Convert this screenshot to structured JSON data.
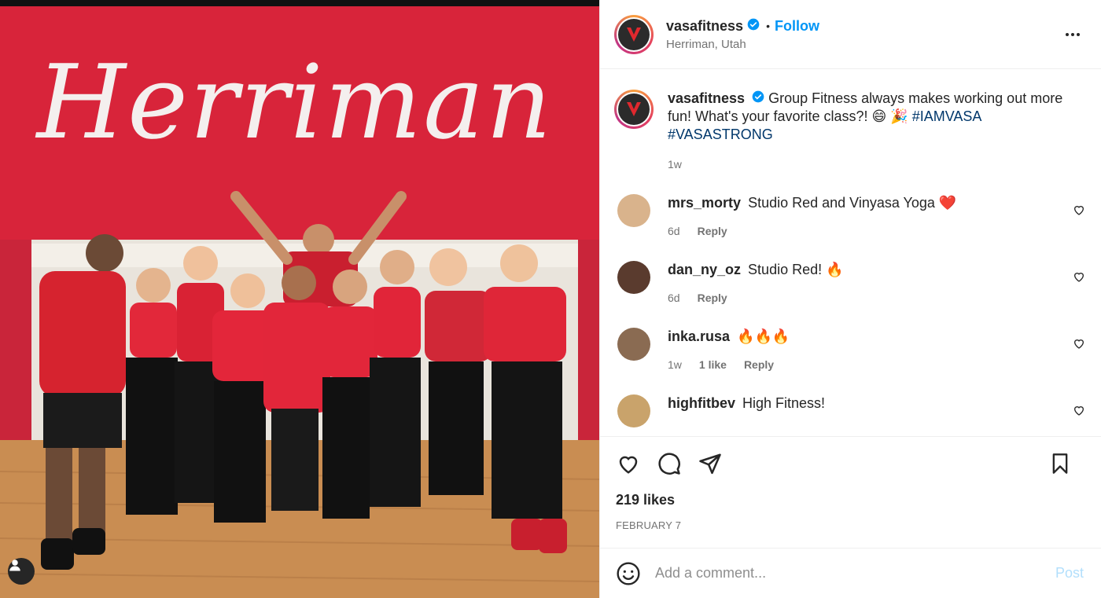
{
  "photo": {
    "sign_text": "Herriman"
  },
  "post": {
    "author": "vasafitness",
    "follow_label": "Follow",
    "dot": "•",
    "location": "Herriman, Utah",
    "logo_text": "VASA",
    "caption": {
      "username": "vasafitness",
      "text": "Group Fitness always makes working out more fun! What's your favorite class?! 😄 🎉",
      "hashtags": [
        "#IAMVASA",
        "#VASASTRONG"
      ],
      "time": "1w"
    },
    "comments": [
      {
        "username": "mrs_morty",
        "text": "Studio Red and Vinyasa Yoga ❤️",
        "time": "6d",
        "likes": "",
        "reply": "Reply",
        "avatar_color": "#d9b38c"
      },
      {
        "username": "dan_ny_oz",
        "text": "Studio Red! 🔥",
        "time": "6d",
        "likes": "",
        "reply": "Reply",
        "avatar_color": "#5a3b2e"
      },
      {
        "username": "inka.rusa",
        "text": "🔥🔥🔥",
        "time": "1w",
        "likes": "1 like",
        "reply": "Reply",
        "avatar_color": "#8a6b52"
      },
      {
        "username": "highfitbev",
        "text": "High Fitness!",
        "time": "",
        "likes": "",
        "reply": "",
        "avatar_color": "#c9a36b"
      }
    ],
    "likes": "219 likes",
    "date": "FEBRUARY 7",
    "add_comment_placeholder": "Add a comment...",
    "post_label": "Post"
  },
  "colors": {
    "accent": "#0095f6",
    "hashtag": "#00376b",
    "wall_red": "#d8243a",
    "floor": "#c98d52"
  }
}
